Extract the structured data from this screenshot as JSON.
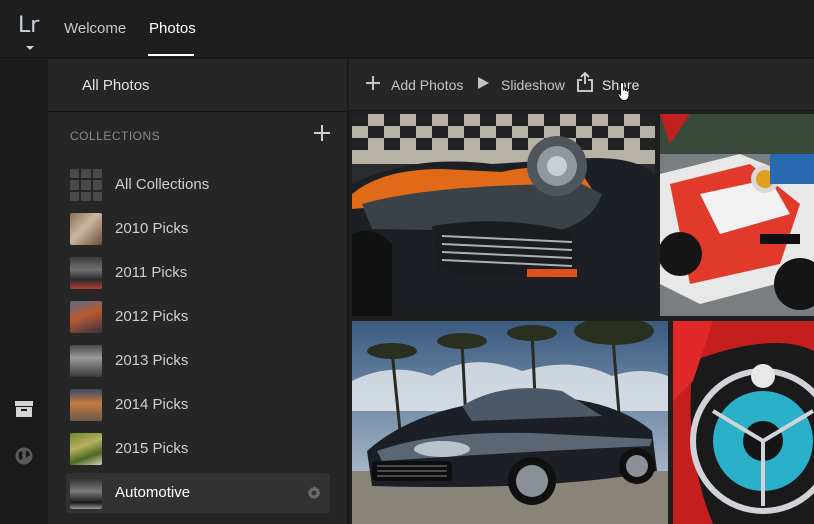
{
  "app": {
    "logo_text": "Lr"
  },
  "nav": {
    "tabs": [
      {
        "label": "Welcome",
        "active": false
      },
      {
        "label": "Photos",
        "active": true
      }
    ]
  },
  "sidebar": {
    "all_photos_label": "All Photos",
    "collections_header": "COLLECTIONS",
    "items": [
      {
        "label": "All Collections",
        "icon": "grid-icon",
        "selected": false
      },
      {
        "label": "2010 Picks",
        "selected": false
      },
      {
        "label": "2011 Picks",
        "selected": false
      },
      {
        "label": "2012 Picks",
        "selected": false
      },
      {
        "label": "2013 Picks",
        "selected": false
      },
      {
        "label": "2014 Picks",
        "selected": false
      },
      {
        "label": "2015 Picks",
        "selected": false
      },
      {
        "label": "Automotive",
        "selected": true
      }
    ]
  },
  "toolbar": {
    "add_photos_label": "Add Photos",
    "slideshow_label": "Slideshow",
    "share_label": "Share"
  },
  "rail": {
    "icons": [
      "archive-icon",
      "globe-icon"
    ]
  },
  "colors": {
    "background": "#1e1e1e",
    "sidebar": "#262626",
    "selected_row": "#323232",
    "logo": "#c9d3e0"
  }
}
